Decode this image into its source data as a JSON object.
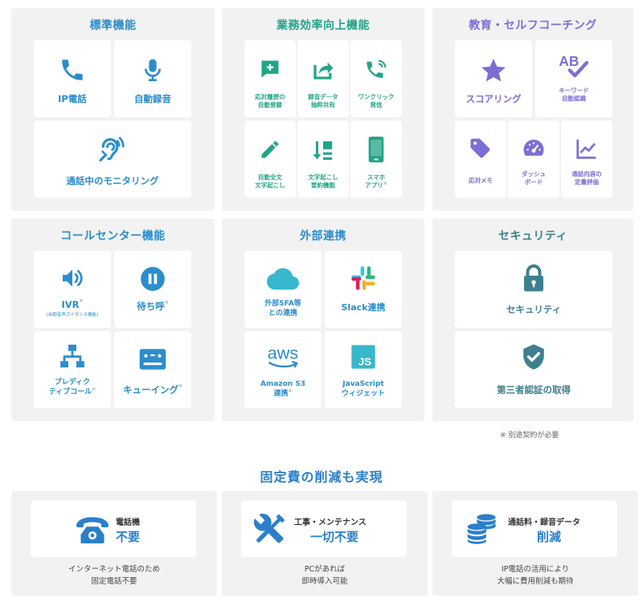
{
  "standard": {
    "title": "標準機能",
    "ip_phone": "IP電話",
    "auto_record": "自動録音",
    "monitoring": "通話中のモニタリング"
  },
  "efficiency": {
    "title": "業務効率向上機能",
    "history": [
      "応対履歴の",
      "自動登録"
    ],
    "extract": [
      "録音データ",
      "抽粋共有"
    ],
    "oneclick": [
      "ワンクリック",
      "発信"
    ],
    "transcribe": [
      "自動全文",
      "文字起こし"
    ],
    "summary": [
      "文字起こし",
      "要約機能"
    ],
    "smartphone": [
      "スマホ",
      "アプリ"
    ],
    "note_mark": "※"
  },
  "education": {
    "title": "教育・セルフコーチング",
    "scoring": "スコアリング",
    "keyword": [
      "キーワード",
      "自動認識"
    ],
    "memo": "応対メモ",
    "dashboard": [
      "ダッシュ",
      "ボード"
    ],
    "evaluation": [
      "通話内容の",
      "定量評価"
    ],
    "ab_text": "AB"
  },
  "callcenter": {
    "title": "コールセンター機能",
    "ivr": "IVR",
    "ivr_sub": "(自動音声ガイダンス機能)",
    "hold": "待ち呼",
    "predictive": [
      "プレディク",
      "ティブコール"
    ],
    "queuing": "キューイング",
    "note_mark": "※"
  },
  "integration": {
    "title": "外部連携",
    "sfa": [
      "外部SFA等",
      "との連携"
    ],
    "slack": "Slack連携",
    "aws": [
      "Amazon S3",
      "連携"
    ],
    "aws_logo": "aws",
    "js": [
      "JavaScript",
      "ウィジェット"
    ],
    "js_logo": "JS",
    "note_mark": "※"
  },
  "security": {
    "title": "セキュリティ",
    "security": "セキュリティ",
    "certification": "第三者認証の取得"
  },
  "note": "※ 別途契約が必要",
  "headline": "固定費の削減も実現",
  "benefits": [
    {
      "small": "電話機",
      "big": "不要",
      "desc": [
        "インターネット電話のため",
        "固定電話不要"
      ]
    },
    {
      "small": "工事・メンテナンス",
      "big": "一切不要",
      "desc": [
        "PCがあれば",
        "即時導入可能"
      ]
    },
    {
      "small": "通話料・録音データ",
      "big": "削減",
      "desc": [
        "IP電話の活用により",
        "大幅に費用削減も期待"
      ]
    }
  ],
  "colors": {
    "blue": "#2b8dcc",
    "green": "#22a58a",
    "purple": "#7b6fd4",
    "teal": "#3e7f8e",
    "headline": "#2b7fc9"
  }
}
